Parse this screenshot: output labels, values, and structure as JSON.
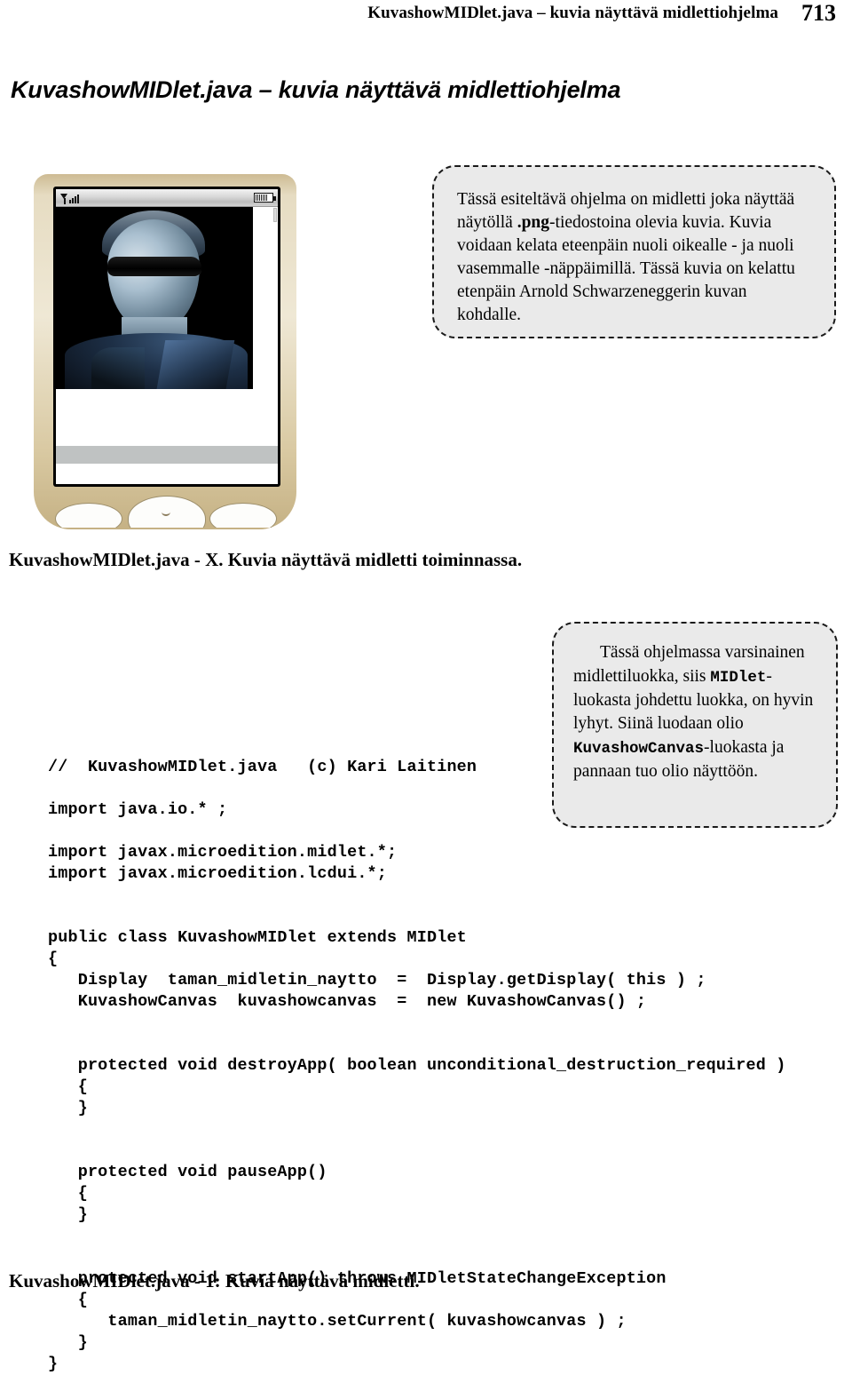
{
  "running_head": {
    "title": "KuvashowMIDlet.java – kuvia näyttävä midlettiohjelma",
    "page_number": "713"
  },
  "chapter_title": "KuvashowMIDlet.java – kuvia näyttävä midlettiohjelma",
  "figure": {
    "caption": "KuvashowMIDlet.java - X.  Kuvia näyttävä midletti toiminnassa.",
    "phone": {
      "status_bar": {
        "signal_icon": "signal-bars-icon",
        "battery_icon": "battery-icon"
      },
      "screen_image_alt": "Arnold Schwarzenegger Terminator kuva"
    }
  },
  "callouts": [
    {
      "id": "callout-program-description",
      "parts": [
        {
          "type": "text",
          "value": "Tässä esiteltävä ohjelma on midletti joka näyttää näytöllä "
        },
        {
          "type": "bold",
          "value": ".png"
        },
        {
          "type": "text",
          "value": "-tiedostoina olevia kuvia. Kuvia voidaan kelata eteenpäin nuoli oikealle - ja nuoli vasemmalle -näppäimillä. Tässä kuvia on kelattu etenpäin Arnold Schwarzeneggerin kuvan kohdalle."
        }
      ],
      "plain": "Tässä esiteltävä ohjelma on midletti joka näyttää näytöllä .png-tiedostoina olevia kuvia. Kuvia voidaan kelata eteenpäin nuoli oikealle - ja nuoli vasemmalle -näppäimillä. Tässä kuvia on kelattu etenpäin Arnold Schwarzeneggerin kuvan kohdalle."
    },
    {
      "id": "callout-class-description",
      "parts": [
        {
          "type": "text",
          "value": "Tässä ohjelmassa varsinainen midlettiluokka, siis "
        },
        {
          "type": "code",
          "value": "MIDlet"
        },
        {
          "type": "text",
          "value": "-luokasta johdettu luokka, on hyvin lyhyt. Siinä luodaan olio "
        },
        {
          "type": "code",
          "value": "KuvashowCanvas"
        },
        {
          "type": "text",
          "value": "-luokasta ja pannaan tuo olio näyttöön."
        }
      ],
      "plain": "Tässä ohjelmassa varsinainen midlettiluokka, siis MIDlet-luokasta johdettu luokka, on hyvin lyhyt. Siinä luodaan olio KuvashowCanvas-luokasta ja pannaan tuo olio näyttöön."
    }
  ],
  "code_listing": {
    "text": "//  KuvashowMIDlet.java   (c) Kari Laitinen\n\nimport java.io.* ;\n\nimport javax.microedition.midlet.*;\nimport javax.microedition.lcdui.*;\n\n\npublic class KuvashowMIDlet extends MIDlet\n{\n   Display  taman_midletin_naytto  =  Display.getDisplay( this ) ;\n   KuvashowCanvas  kuvashowcanvas  =  new KuvashowCanvas() ;\n\n\n   protected void destroyApp( boolean unconditional_destruction_required )\n   {\n   }\n\n\n   protected void pauseApp()\n   {\n   }\n\n\n   protected void startApp() throws MIDletStateChangeException\n   {\n      taman_midletin_naytto.setCurrent( kuvashowcanvas ) ;\n   }\n}",
    "caption": "KuvashowMIDlet.java - 1:  Kuvia näyttävä midletti."
  }
}
